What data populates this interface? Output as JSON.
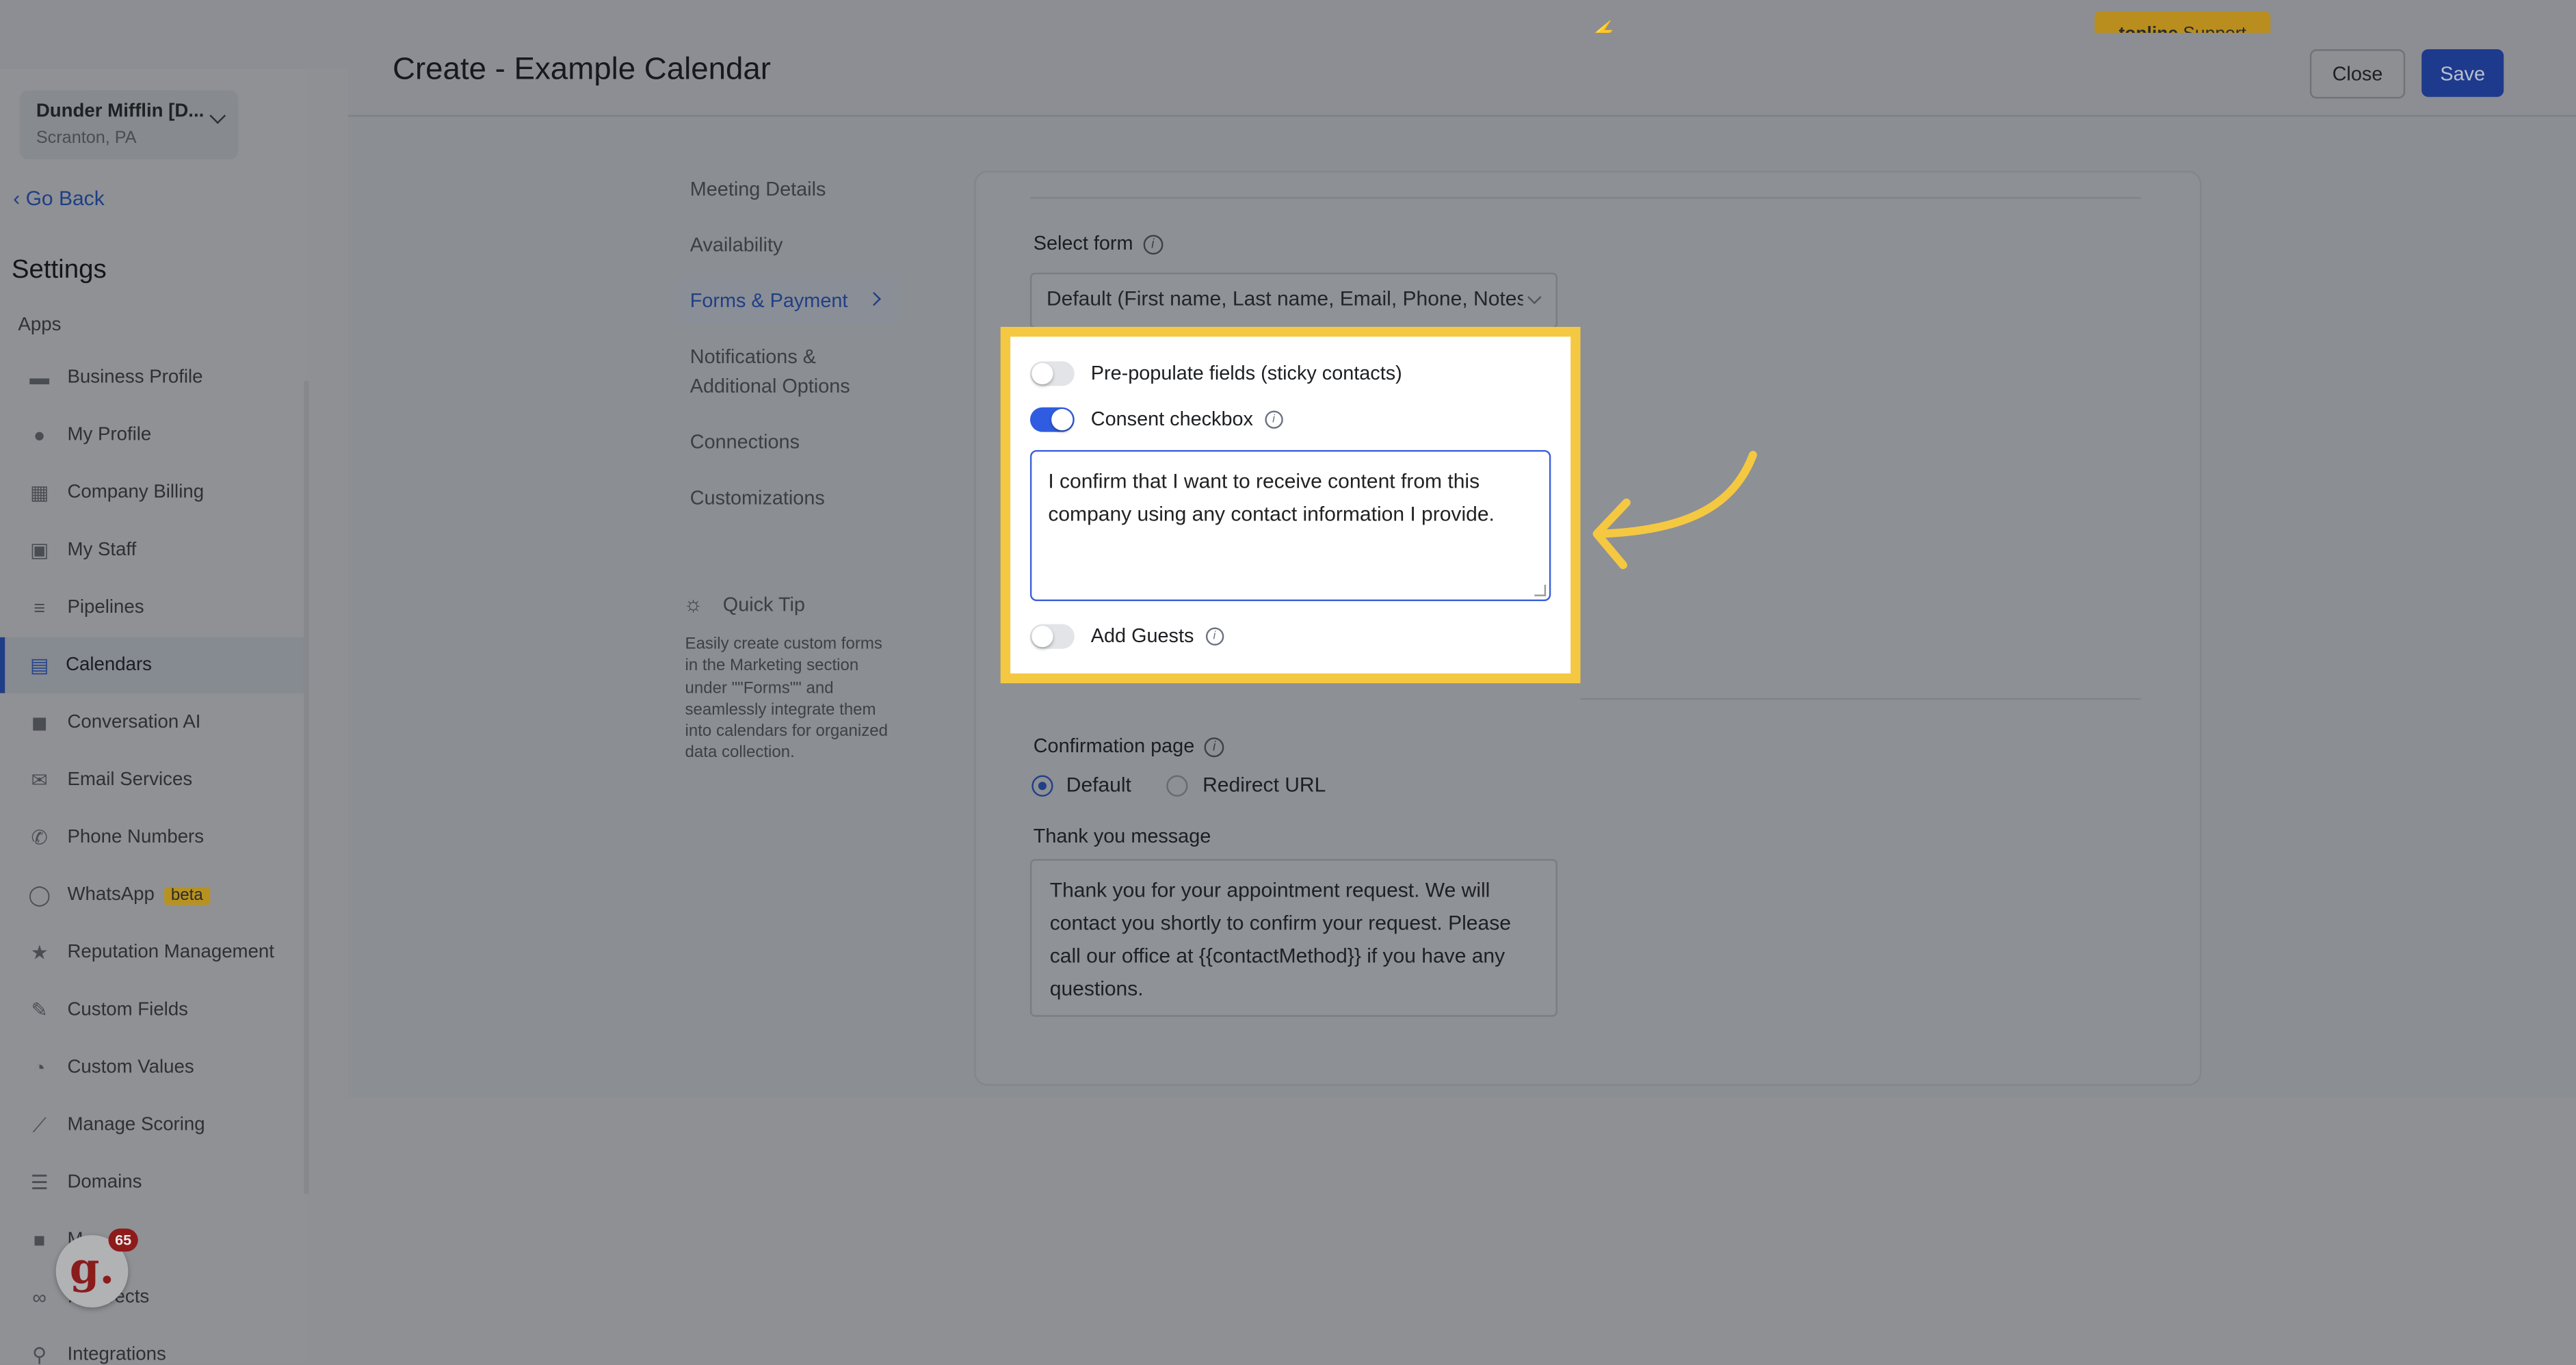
{
  "topbar": {
    "support_brand": "topline",
    "support_label": "Support"
  },
  "sidebar": {
    "account_name": "Dunder Mifflin [D...",
    "account_location": "Scranton, PA",
    "go_back": "Go Back",
    "settings_title": "Settings",
    "apps_label": "Apps",
    "items": [
      {
        "label": "Business Profile",
        "icon": "briefcase-icon"
      },
      {
        "label": "My Profile",
        "icon": "user-icon"
      },
      {
        "label": "Company Billing",
        "icon": "grid-icon"
      },
      {
        "label": "My Staff",
        "icon": "staff-icon"
      },
      {
        "label": "Pipelines",
        "icon": "filter-icon"
      },
      {
        "label": "Calendars",
        "icon": "calendar-icon",
        "active": true
      },
      {
        "label": "Conversation AI",
        "icon": "chat-icon"
      },
      {
        "label": "Email Services",
        "icon": "email-icon"
      },
      {
        "label": "Phone Numbers",
        "icon": "phone-icon"
      },
      {
        "label": "WhatsApp",
        "icon": "whatsapp-icon",
        "badge": "beta"
      },
      {
        "label": "Reputation Management",
        "icon": "star-icon"
      },
      {
        "label": "Custom Fields",
        "icon": "edit-icon"
      },
      {
        "label": "Custom Values",
        "icon": "pie-icon"
      },
      {
        "label": "Manage Scoring",
        "icon": "chart-icon"
      },
      {
        "label": "Domains",
        "icon": "domain-icon"
      },
      {
        "label": "M...",
        "icon": "video-icon"
      },
      {
        "label": "...edirects",
        "icon": "link-icon"
      },
      {
        "label": "Integrations",
        "icon": "integrations-icon"
      }
    ],
    "notification_count": "65"
  },
  "header": {
    "title": "Create - Example Calendar",
    "close_label": "Close",
    "save_label": "Save"
  },
  "tabs": [
    {
      "label": "Meeting Details"
    },
    {
      "label": "Availability"
    },
    {
      "label": "Forms & Payment",
      "active": true
    },
    {
      "label": "Notifications & Additional Options"
    },
    {
      "label": "Connections"
    },
    {
      "label": "Customizations"
    }
  ],
  "quick_tip": {
    "title": "Quick Tip",
    "body": "Easily create custom forms in the Marketing section under \"\"Forms\"\" and seamlessly integrate them into calendars for organized data collection."
  },
  "form": {
    "select_form_label": "Select form",
    "select_form_value": "Default (First name, Last name, Email, Phone, Notes)",
    "prepopulate_label": "Pre-populate fields (sticky contacts)",
    "prepopulate_on": false,
    "consent_label": "Consent checkbox",
    "consent_on": true,
    "consent_text": "I confirm that I want to receive content from this company using any contact information I provide.",
    "add_guests_label": "Add Guests",
    "add_guests_on": false,
    "confirmation_label": "Confirmation page",
    "radio_default": "Default",
    "radio_redirect": "Redirect URL",
    "thank_you_label": "Thank you message",
    "thank_you_text": "Thank you for your appointment request. We will contact you shortly to confirm your request. Please call our office at {{contactMethod}} if you have any questions."
  },
  "colors": {
    "highlight": "#f5c842",
    "accent": "#2f5ce0"
  }
}
